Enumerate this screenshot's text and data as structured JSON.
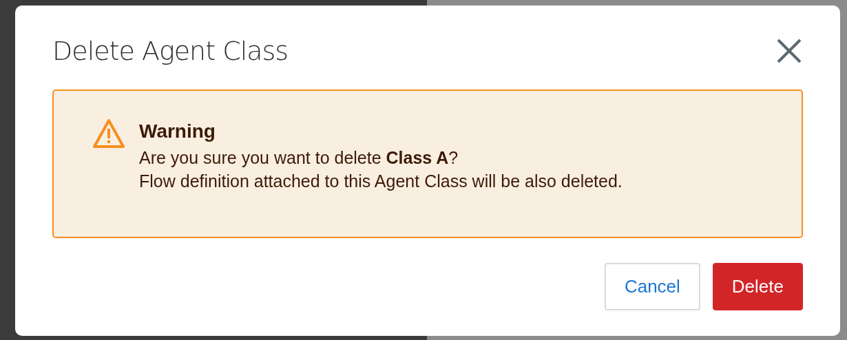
{
  "dialog": {
    "title": "Delete Agent Class",
    "alert": {
      "kind": "warning",
      "heading": "Warning",
      "lines": [
        "Are you sure you want to delete **Class A**?",
        "Flow definition attached to this Agent Class will be also deleted."
      ]
    },
    "buttons": [
      {
        "label": "Cancel",
        "kind": "secondary"
      },
      {
        "label": "Delete",
        "kind": "danger"
      }
    ]
  }
}
